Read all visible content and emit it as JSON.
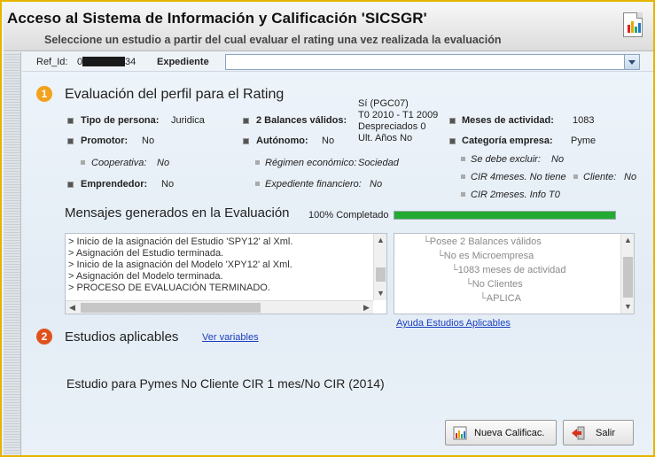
{
  "window": {
    "title": "Acceso al Sistema de Información y Calificación 'SICSGR'",
    "subtitle": "Seleccione un estudio a partir del cual evaluar el rating una vez realizada la evaluación",
    "report_icon": "report-chart-icon"
  },
  "refbar": {
    "ref_label": "Ref_Id:",
    "ref_prefix": "0",
    "ref_suffix": "34",
    "expediente_label": "Expediente",
    "expediente_value": ""
  },
  "section1": {
    "number": "1",
    "title": "Evaluación del perfil para el Rating",
    "fields": {
      "tipo_persona_label": "Tipo de persona:",
      "tipo_persona_value": "Juridica",
      "balances_label": "2 Balances válidos:",
      "balances_value_line1": "Sí (PGC07)",
      "balances_value_line2": "T0 2010 - T1 2009",
      "balances_value_line3": "Despreciados 0",
      "balances_value_line4": "Ult. Años No",
      "meses_label": "Meses de actividad:",
      "meses_value": "1083",
      "promotor_label": "Promotor:",
      "promotor_value": "No",
      "autonomo_label": "Autónomo:",
      "autonomo_value": "No",
      "categoria_label": "Categoría empresa:",
      "categoria_value": "Pyme",
      "cooperativa_label": "Cooperativa:",
      "cooperativa_value": "No",
      "regimen_label": "Régimen económico:",
      "regimen_value": "Sociedad",
      "excluir_label": "Se debe excluir:",
      "excluir_value": "No",
      "cir4_label": "CIR 4meses. No tiene",
      "cliente_label": "Cliente:",
      "cliente_value": "No",
      "emprendedor_label": "Emprendedor:",
      "emprendedor_value": "No",
      "expediente_fin_label": "Expediente financiero:",
      "expediente_fin_value": "No",
      "cir2_label": "CIR 2meses. Info T0"
    }
  },
  "messages": {
    "title": "Mensajes generados en la Evaluación",
    "progress_text": "100% Completado",
    "progress_value": 1.0,
    "log": [
      "> Inicio de la asignación del Estudio 'SPY12' al Xml.",
      "> Asignación del Estudio terminada.",
      "> Inicio de la asignación del Modelo 'XPY12' al Xml.",
      "> Asignación del Modelo terminada.",
      "> PROCESO DE EVALUACIÓN TERMINADO."
    ],
    "tree": [
      "Posee 2 Balances válidos",
      "No es Microempresa",
      "1083 meses de actividad",
      "No Clientes",
      "APLICA"
    ],
    "help_link": "Ayuda Estudios Aplicables"
  },
  "section2": {
    "number": "2",
    "title": "Estudios aplicables",
    "link": "Ver variables",
    "study": "Estudio para Pymes No Cliente CIR 1 mes/No CIR (2014)"
  },
  "buttons": {
    "nueva": "Nueva Calificac.",
    "salir": "Salir"
  },
  "colors": {
    "frame_border": "#e8b400",
    "badge1": "#f2a21c",
    "badge2": "#e0521c",
    "progress": "#22aa33",
    "link": "#1a3fbf"
  }
}
